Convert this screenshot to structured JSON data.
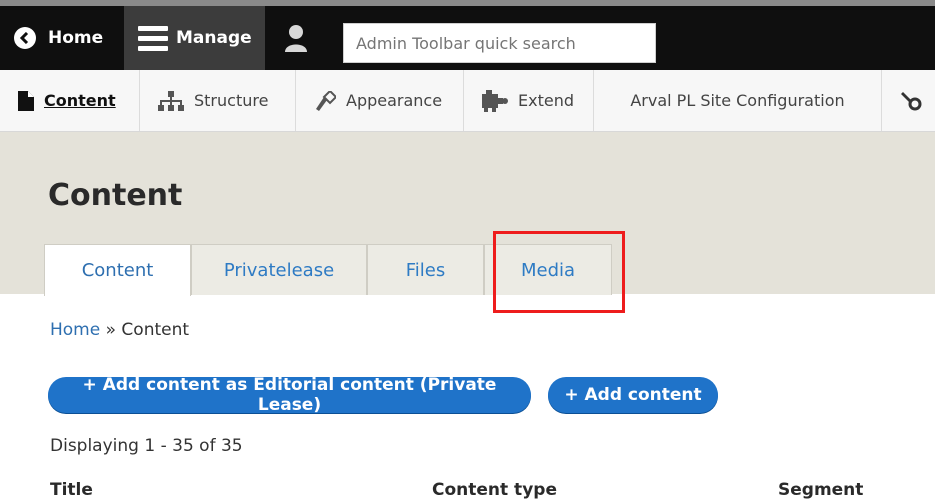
{
  "toolbar": {
    "home_label": "Home",
    "manage_label": "Manage",
    "search_placeholder": "Admin Toolbar quick search"
  },
  "tray": {
    "items": [
      {
        "label": "Content",
        "icon": "content-icon"
      },
      {
        "label": "Structure",
        "icon": "structure-icon"
      },
      {
        "label": "Appearance",
        "icon": "appearance-icon"
      },
      {
        "label": "Extend",
        "icon": "extend-icon"
      },
      {
        "label": "Arval PL Site Configuration"
      },
      {
        "label": "",
        "icon": "wrench-icon"
      }
    ]
  },
  "page": {
    "title": "Content",
    "tabs": [
      {
        "label": "Content",
        "active": true
      },
      {
        "label": "Privatelease"
      },
      {
        "label": "Files"
      },
      {
        "label": "Media",
        "highlighted": true
      }
    ],
    "breadcrumb": {
      "home": "Home",
      "separator": " » ",
      "current": "Content"
    },
    "buttons": {
      "add_editorial": "+ Add content as Editorial content (Private Lease)",
      "add_content": "+ Add content"
    },
    "displaying": {
      "prefix": "Displaying ",
      "start": "1",
      "dash": " - ",
      "end": "35",
      "of": " of 35"
    },
    "table": {
      "headers": [
        "Title",
        "Content type",
        "Segment"
      ]
    }
  },
  "colors": {
    "toolbar_bg": "#0f0f0f",
    "manage_bg": "#3c3c3c",
    "header_bg": "#e4e2d9",
    "button_blue": "#1f73c9",
    "link_blue": "#2e6fb0",
    "highlight_red": "#ee1c1c"
  }
}
